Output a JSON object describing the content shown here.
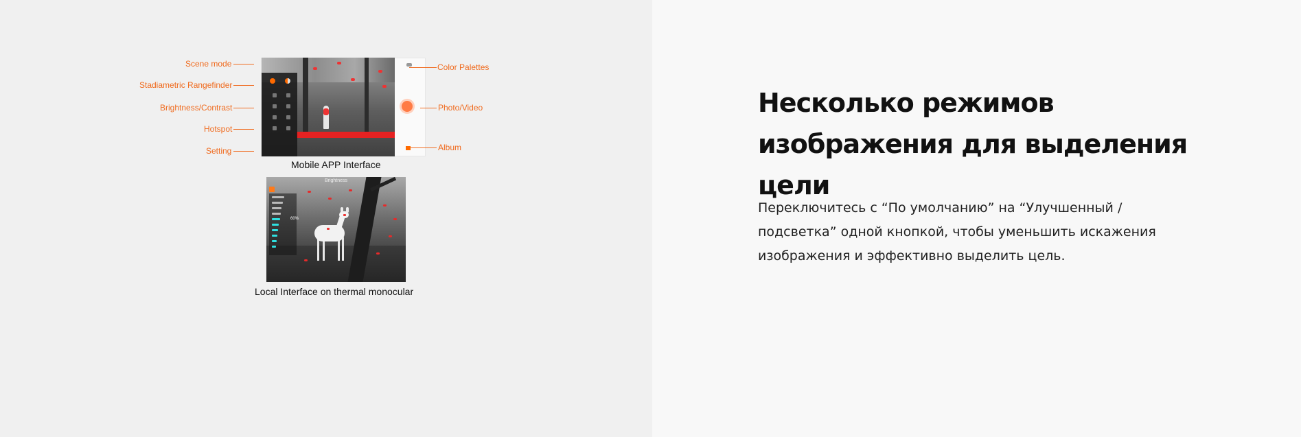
{
  "content": {
    "headline": "Несколько режимов изображения для выделения цели",
    "description": "Переключитесь с “По умолчанию” на “Улучшенный / подсветка” одной кнопкой, чтобы уменьшить искажения изображения и эффективно выделить цель."
  },
  "app_interface": {
    "caption": "Mobile APP  Interface",
    "labels": {
      "scene_mode": "Scene mode",
      "rangefinder": "Stadiametric Rangefinder",
      "brightness": "Brightness/Contrast",
      "hotspot": "Hotspot",
      "setting": "Setting",
      "palettes": "Color Palettes",
      "photo_video": "Photo/Video",
      "album": "Album"
    },
    "accent_color": "#f06a1d"
  },
  "monocular_interface": {
    "caption": "Local Interface on thermal monocular",
    "overlay_title": "Brightness",
    "brightness_level": "60%"
  }
}
